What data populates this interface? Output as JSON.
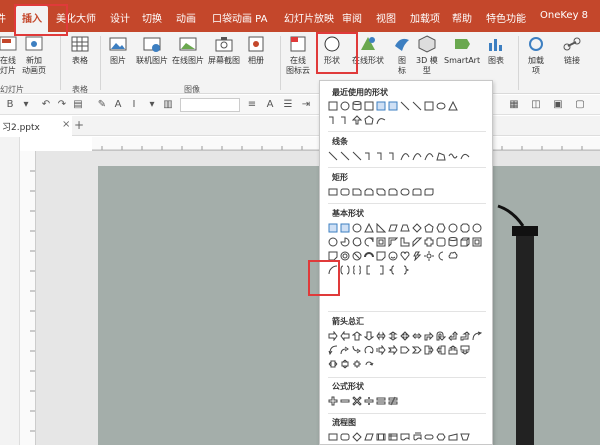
{
  "tabs": [
    {
      "label": "文件",
      "partial": "件"
    },
    {
      "label": "插入",
      "active": true
    },
    {
      "label": "美化大师"
    },
    {
      "label": "设计"
    },
    {
      "label": "切换"
    },
    {
      "label": "动画"
    },
    {
      "label": "口袋动画 PA"
    },
    {
      "label": "幻灯片放映"
    },
    {
      "label": "审阅"
    },
    {
      "label": "视图"
    },
    {
      "label": "加载项"
    },
    {
      "label": "帮助"
    },
    {
      "label": "特色功能"
    },
    {
      "label": "OneKey 8"
    }
  ],
  "ribbon": {
    "new_slide": "在线\n灯片",
    "new_anim_page": "新加\n动画页",
    "table": "表格",
    "picture": "图片",
    "online_pic": "联机图片",
    "online_pic2": "在线图片",
    "screenshot": "屏幕截图",
    "album": "相册",
    "online_icons": "在线\n图标云",
    "shapes": "形状",
    "online_shapes": "在线形状",
    "icons": "图\n标",
    "model3d": "3D 模\n型",
    "smartart": "SmartArt",
    "chart": "图表",
    "addins": "加载\n项",
    "link": "链接",
    "group_slides": "幻灯片",
    "group_tables": "表格",
    "group_images": "图像"
  },
  "doc_tab": "习2.pptx",
  "panel": {
    "recent": "最近使用的形状",
    "lines": "线条",
    "rect": "矩形",
    "basic": "基本形状",
    "arrows": "箭头总汇",
    "formula": "公式形状",
    "flowchart": "流程图"
  }
}
